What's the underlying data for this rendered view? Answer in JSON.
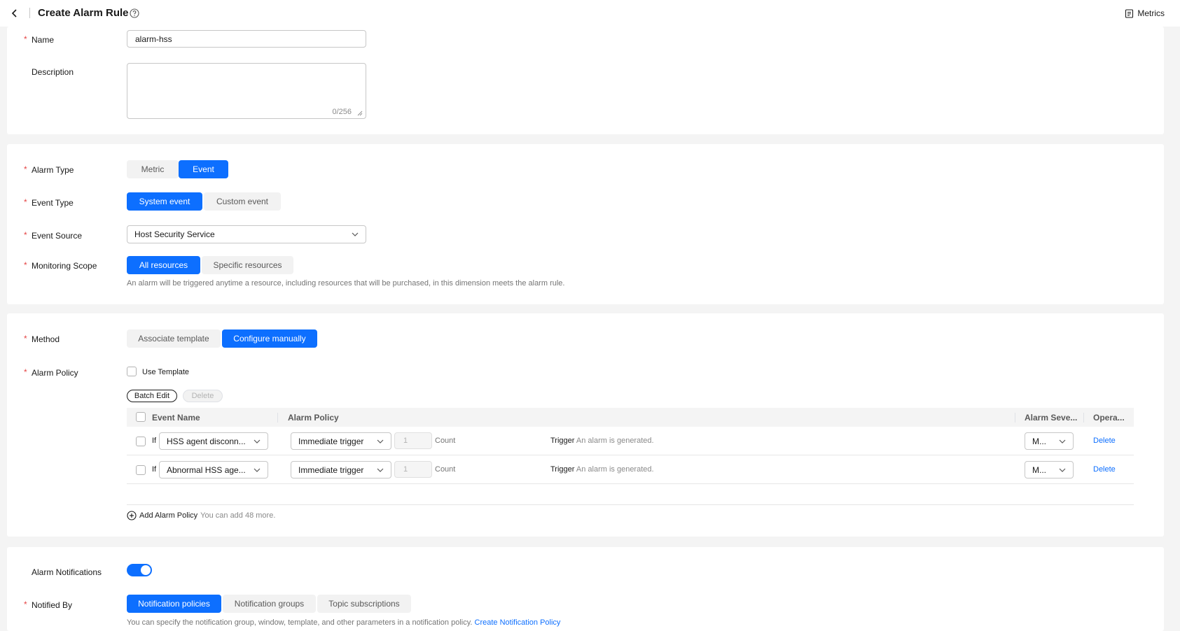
{
  "header": {
    "title": "Create Alarm Rule",
    "metrics_label": "Metrics"
  },
  "basic": {
    "name_label": "Name",
    "name_value": "alarm-hss",
    "description_label": "Description",
    "description_counter": "0/256"
  },
  "alarm": {
    "alarm_type_label": "Alarm Type",
    "alarm_type_options": [
      "Metric",
      "Event"
    ],
    "alarm_type_selected": "Event",
    "event_type_label": "Event Type",
    "event_type_options": [
      "System event",
      "Custom event"
    ],
    "event_type_selected": "System event",
    "event_source_label": "Event Source",
    "event_source_value": "Host Security Service",
    "scope_label": "Monitoring Scope",
    "scope_options": [
      "All resources",
      "Specific resources"
    ],
    "scope_selected": "All resources",
    "scope_hint": "An alarm will be triggered anytime a resource, including resources that will be purchased, in this dimension meets the alarm rule."
  },
  "method": {
    "method_label": "Method",
    "method_options": [
      "Associate template",
      "Configure manually"
    ],
    "method_selected": "Configure manually",
    "policy_label": "Alarm Policy",
    "use_template_label": "Use Template",
    "batch_edit_label": "Batch Edit",
    "delete_label": "Delete",
    "table": {
      "columns": [
        "Event Name",
        "Alarm Policy",
        "Alarm Seve...",
        "Opera..."
      ],
      "rows": [
        {
          "if_label": "If",
          "event_name": "HSS agent disconn...",
          "trigger_mode": "Immediate trigger",
          "count_value": "1",
          "count_label": "Count",
          "trigger_label": "Trigger",
          "trigger_text": "An alarm is generated.",
          "severity": "M...",
          "operation": "Delete"
        },
        {
          "if_label": "If",
          "event_name": "Abnormal HSS age...",
          "trigger_mode": "Immediate trigger",
          "count_value": "1",
          "count_label": "Count",
          "trigger_label": "Trigger",
          "trigger_text": "An alarm is generated.",
          "severity": "M...",
          "operation": "Delete"
        }
      ]
    },
    "add_policy_label": "Add Alarm Policy",
    "add_policy_hint": "You can add 48 more."
  },
  "notification": {
    "alarm_notifications_label": "Alarm Notifications",
    "alarm_notifications_enabled": true,
    "notified_by_label": "Notified By",
    "notified_by_options": [
      "Notification policies",
      "Notification groups",
      "Topic subscriptions"
    ],
    "notified_by_selected": "Notification policies",
    "hint": "You can specify the notification group, window, template, and other parameters in a notification policy.",
    "create_link": "Create Notification Policy"
  },
  "colors": {
    "primary": "#0d6fff",
    "required": "#e54545",
    "background": "#f4f4f4"
  }
}
